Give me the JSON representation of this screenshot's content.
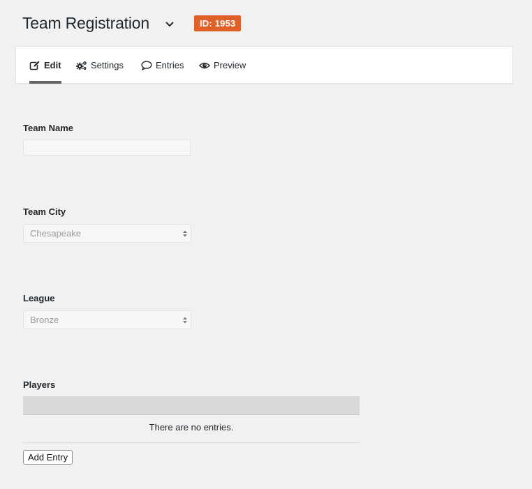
{
  "header": {
    "title": "Team Registration",
    "id_badge": "ID: 1953",
    "badge_color": "#e0602a"
  },
  "tabs": [
    {
      "label": "Edit",
      "icon": "edit-icon",
      "active": true
    },
    {
      "label": "Settings",
      "icon": "gears-icon",
      "active": false
    },
    {
      "label": "Entries",
      "icon": "speech-bubble-icon",
      "active": false
    },
    {
      "label": "Preview",
      "icon": "eye-icon",
      "active": false
    }
  ],
  "form": {
    "team_name": {
      "label": "Team Name",
      "value": ""
    },
    "team_city": {
      "label": "Team City",
      "value": "Chesapeake"
    },
    "league": {
      "label": "League",
      "value": "Bronze"
    },
    "players": {
      "label": "Players",
      "empty_text": "There are no entries.",
      "add_button": "Add Entry"
    }
  }
}
